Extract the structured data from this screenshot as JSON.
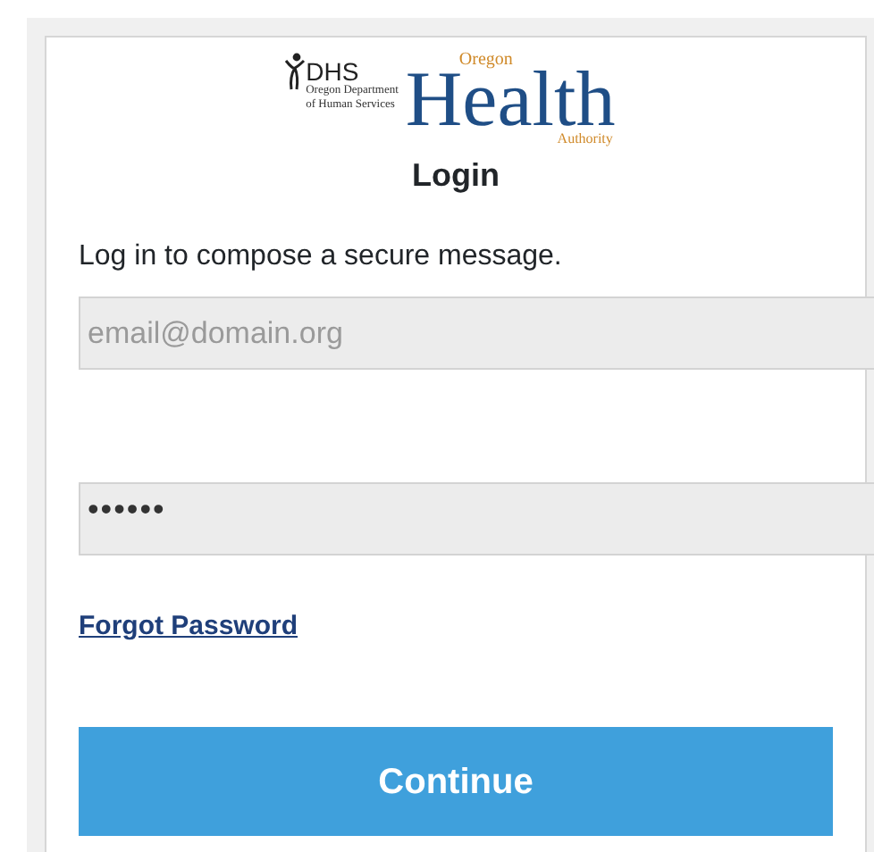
{
  "logo": {
    "dhs": "DHS",
    "dhs_line_1": "Oregon Department",
    "dhs_line_2": "of Human Services",
    "oha_top": "Oregon",
    "oha_main": "Health",
    "oha_bottom": "Authority"
  },
  "title": "Login",
  "intro": "Log in to compose a secure message.",
  "email": {
    "placeholder": "email@domain.org"
  },
  "password": {
    "value": "••••••"
  },
  "forgot_link": "Forgot Password",
  "continue_button": "Continue"
}
